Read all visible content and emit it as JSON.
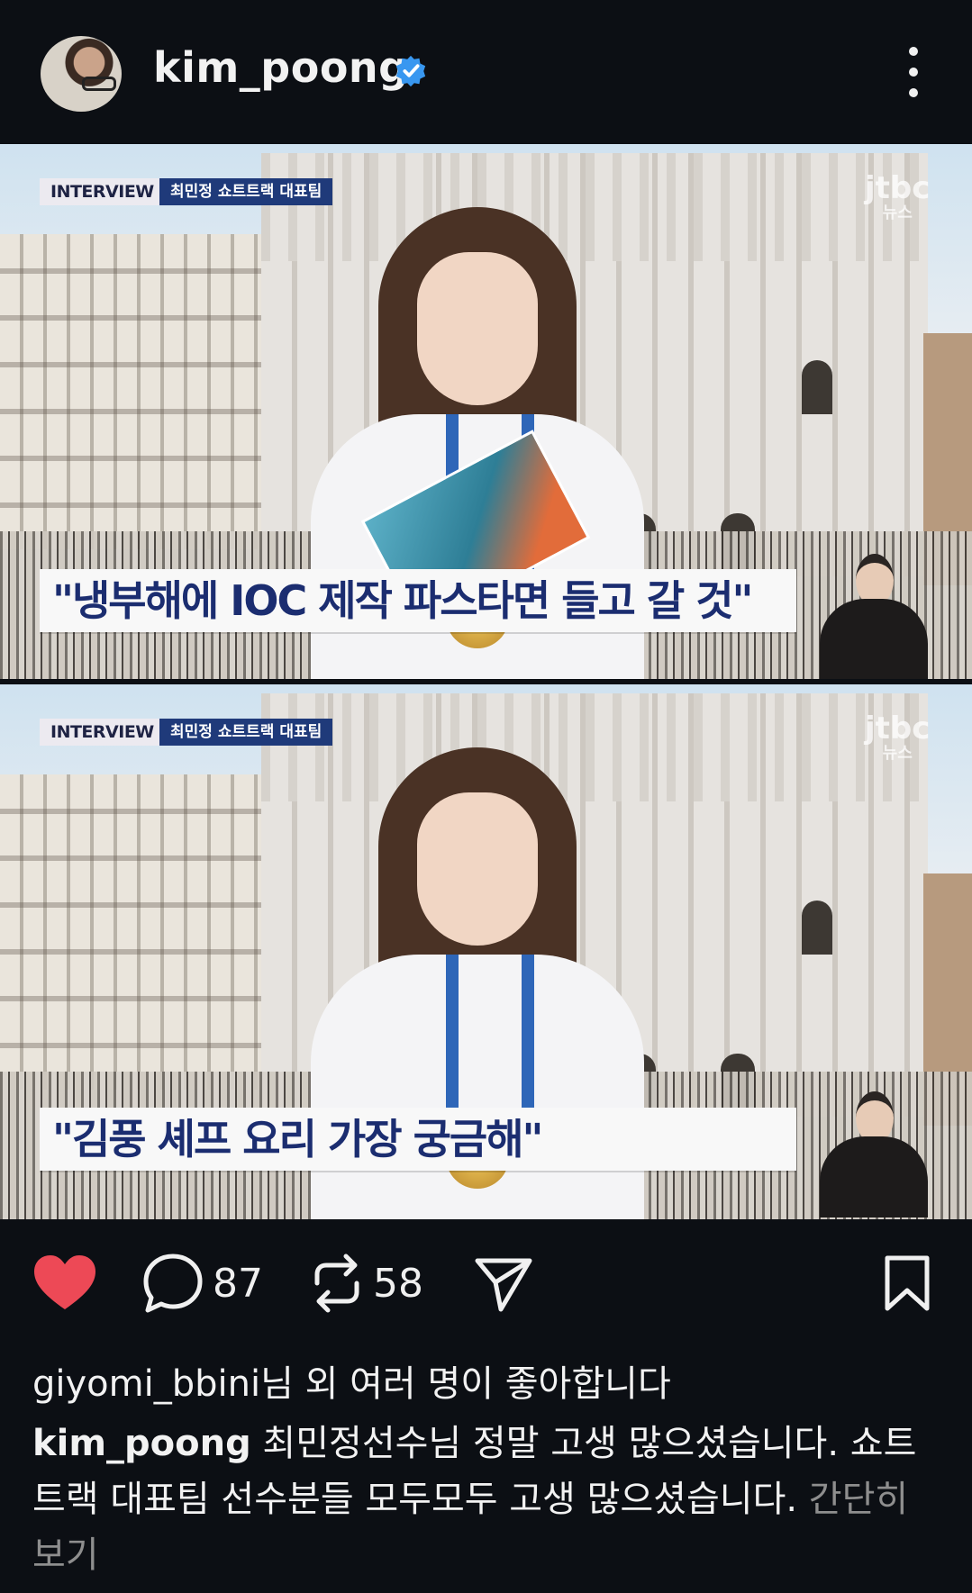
{
  "header": {
    "username": "kim_poong",
    "verified_icon": "verified-badge-icon",
    "menu_icon": "more-vertical-icon"
  },
  "frames": [
    {
      "tag_interview": "INTERVIEW",
      "tag_name": "최민정 쇼트트랙 대표팀",
      "broadcaster": "jtbc",
      "broadcaster_sub": "뉴스",
      "caption": "\"냉부해에 IOC 제작 파스타면 들고 갈 것\""
    },
    {
      "tag_interview": "INTERVIEW",
      "tag_name": "최민정 쇼트트랙 대표팀",
      "broadcaster": "jtbc",
      "broadcaster_sub": "뉴스",
      "caption": "\"김풍 셰프 요리 가장 궁금해\""
    }
  ],
  "actions": {
    "comments_count": "87",
    "reposts_count": "58",
    "like_color": "#ed4956"
  },
  "likes": {
    "user": "giyomi_bbini",
    "suffix": "님 외 여러 명이 좋아합니다"
  },
  "caption": {
    "user": "kim_poong",
    "text": " 최민정선수님 정말 고생 많으셨습니다. 쇼트트랙 대표팀 선수분들 모두모두 고생 많으셨습니다.",
    "more": " 간단히 보기"
  }
}
